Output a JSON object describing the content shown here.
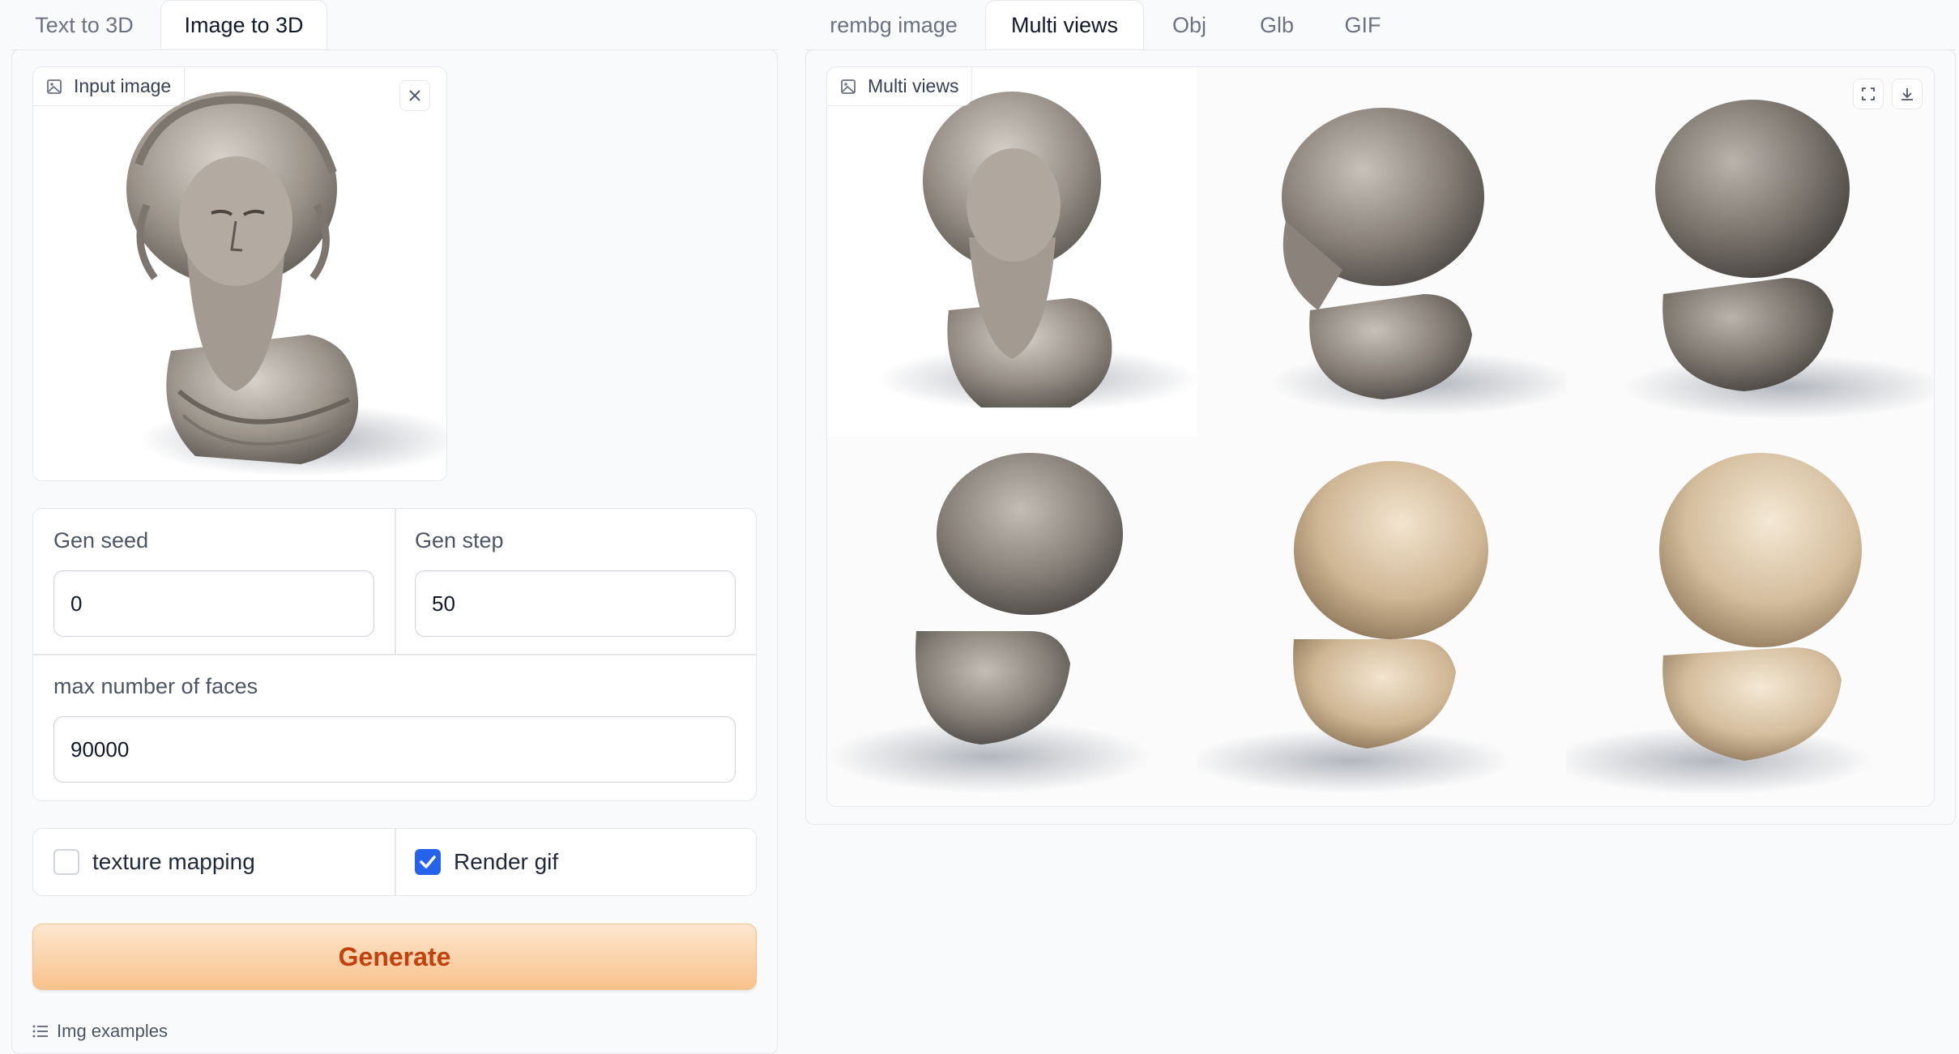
{
  "left_tabs": [
    {
      "label": "Text to 3D",
      "active": false
    },
    {
      "label": "Image to 3D",
      "active": true
    }
  ],
  "right_tabs": [
    {
      "label": "rembg image",
      "active": false
    },
    {
      "label": "Multi views",
      "active": true
    },
    {
      "label": "Obj",
      "active": false
    },
    {
      "label": "Glb",
      "active": false
    },
    {
      "label": "GIF",
      "active": false
    }
  ],
  "input_image": {
    "label": "Input image",
    "icon": "image-icon",
    "close_icon": "close-icon"
  },
  "params": {
    "gen_seed": {
      "label": "Gen seed",
      "value": "0"
    },
    "gen_step": {
      "label": "Gen step",
      "value": "50"
    },
    "max_faces": {
      "label": "max number of faces",
      "value": "90000"
    }
  },
  "options": {
    "texture_mapping": {
      "label": "texture mapping",
      "checked": false
    },
    "render_gif": {
      "label": "Render gif",
      "checked": true
    }
  },
  "generate_label": "Generate",
  "examples_label": "Img examples",
  "multi_views": {
    "label": "Multi views",
    "icon": "image-icon",
    "fullscreen_icon": "fullscreen-icon",
    "download_icon": "download-icon",
    "view_count": 6
  },
  "colors": {
    "accent_blue": "#2563eb",
    "generate_text": "#c2410c",
    "generate_bg": "#f8c18a",
    "stone_gray": "#8a8683",
    "stone_beige": "#d9c4a6"
  }
}
